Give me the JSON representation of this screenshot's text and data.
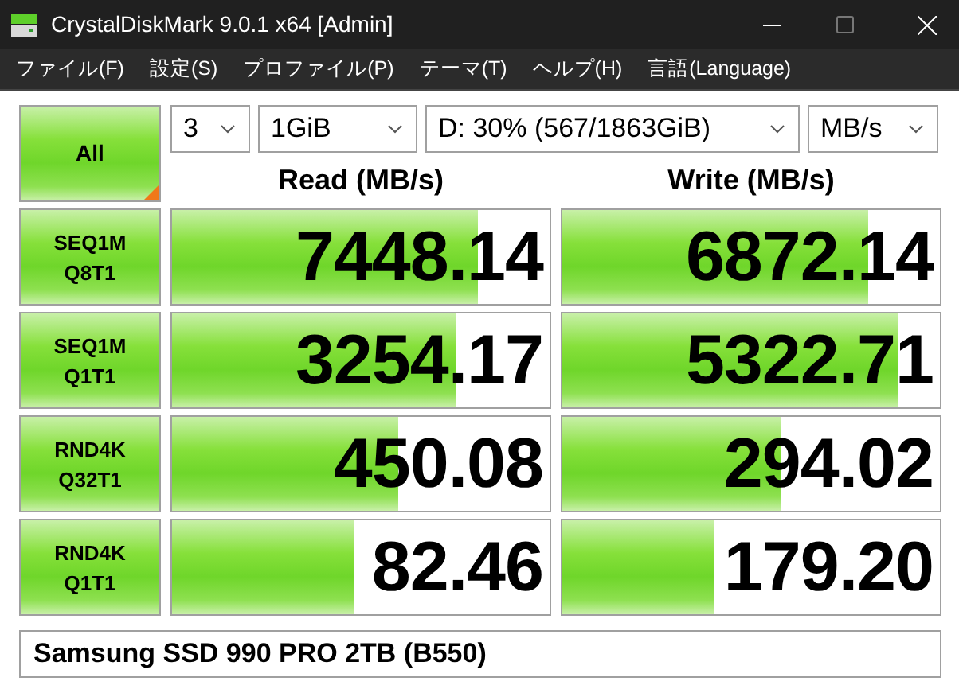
{
  "window": {
    "title": "CrystalDiskMark 9.0.1 x64 [Admin]"
  },
  "menu": [
    "ファイル(F)",
    "設定(S)",
    "プロファイル(P)",
    "テーマ(T)",
    "ヘルプ(H)",
    "言語(Language)"
  ],
  "all_button": {
    "label": "All"
  },
  "selects": [
    {
      "value": "3"
    },
    {
      "value": "1GiB"
    },
    {
      "value": "D: 30% (567/1863GiB)"
    },
    {
      "value": "MB/s"
    }
  ],
  "headings": [
    "Read (MB/s)",
    "Write (MB/s)"
  ],
  "rows": [
    {
      "test": [
        "SEQ1M",
        "Q8T1"
      ],
      "read": {
        "value": "7448.14",
        "level": 0.81
      },
      "write": {
        "value": "6872.14",
        "level": 0.81
      }
    },
    {
      "test": [
        "SEQ1M",
        "Q1T1"
      ],
      "read": {
        "value": "3254.17",
        "level": 0.75
      },
      "write": {
        "value": "5322.71",
        "level": 0.89
      }
    },
    {
      "test": [
        "RND4K",
        "Q32T1"
      ],
      "read": {
        "value": "450.08",
        "level": 0.6
      },
      "write": {
        "value": "294.02",
        "level": 0.58
      }
    },
    {
      "test": [
        "RND4K",
        "Q1T1"
      ],
      "read": {
        "value": "82.46",
        "level": 0.48
      },
      "write": {
        "value": "179.20",
        "level": 0.4
      }
    }
  ],
  "comment": "Samsung SSD 990 PRO 2TB (B550)"
}
